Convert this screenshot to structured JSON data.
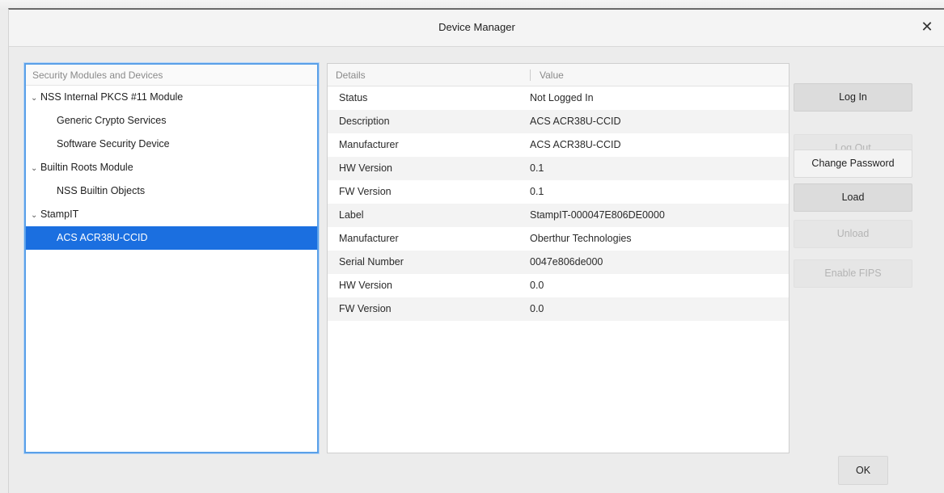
{
  "window": {
    "title": "Device Manager",
    "close_glyph": "✕"
  },
  "tree": {
    "header": "Security Modules and Devices",
    "items": [
      {
        "label": "NSS Internal PKCS #11 Module",
        "level": 0,
        "expanded": true
      },
      {
        "label": "Generic Crypto Services",
        "level": 1
      },
      {
        "label": "Software Security Device",
        "level": 1
      },
      {
        "label": "Builtin Roots Module",
        "level": 0,
        "expanded": true
      },
      {
        "label": "NSS Builtin Objects",
        "level": 1
      },
      {
        "label": "StampIT",
        "level": 0,
        "expanded": true
      },
      {
        "label": "ACS ACR38U-CCID",
        "level": 1,
        "selected": true
      }
    ]
  },
  "details": {
    "col_details": "Details",
    "col_value": "Value",
    "rows": [
      {
        "key": "Status",
        "value": "Not Logged In"
      },
      {
        "key": "Description",
        "value": "ACS ACR38U-CCID"
      },
      {
        "key": "Manufacturer",
        "value": "ACS ACR38U-CCID"
      },
      {
        "key": "HW Version",
        "value": "0.1"
      },
      {
        "key": "FW Version",
        "value": "0.1"
      },
      {
        "key": "Label",
        "value": "StampIT-000047E806DE0000"
      },
      {
        "key": "Manufacturer",
        "value": "Oberthur Technologies"
      },
      {
        "key": "Serial Number",
        "value": "0047e806de000"
      },
      {
        "key": "HW Version",
        "value": "0.0"
      },
      {
        "key": "FW Version",
        "value": "0.0"
      }
    ]
  },
  "buttons": {
    "log_in": "Log In",
    "log_out": "Log Out",
    "change_password": "Change Password",
    "load": "Load",
    "unload": "Unload",
    "enable_fips": "Enable FIPS",
    "ok": "OK"
  },
  "colors": {
    "selection": "#1b6fe0",
    "focus_ring": "#5aa0e8"
  }
}
